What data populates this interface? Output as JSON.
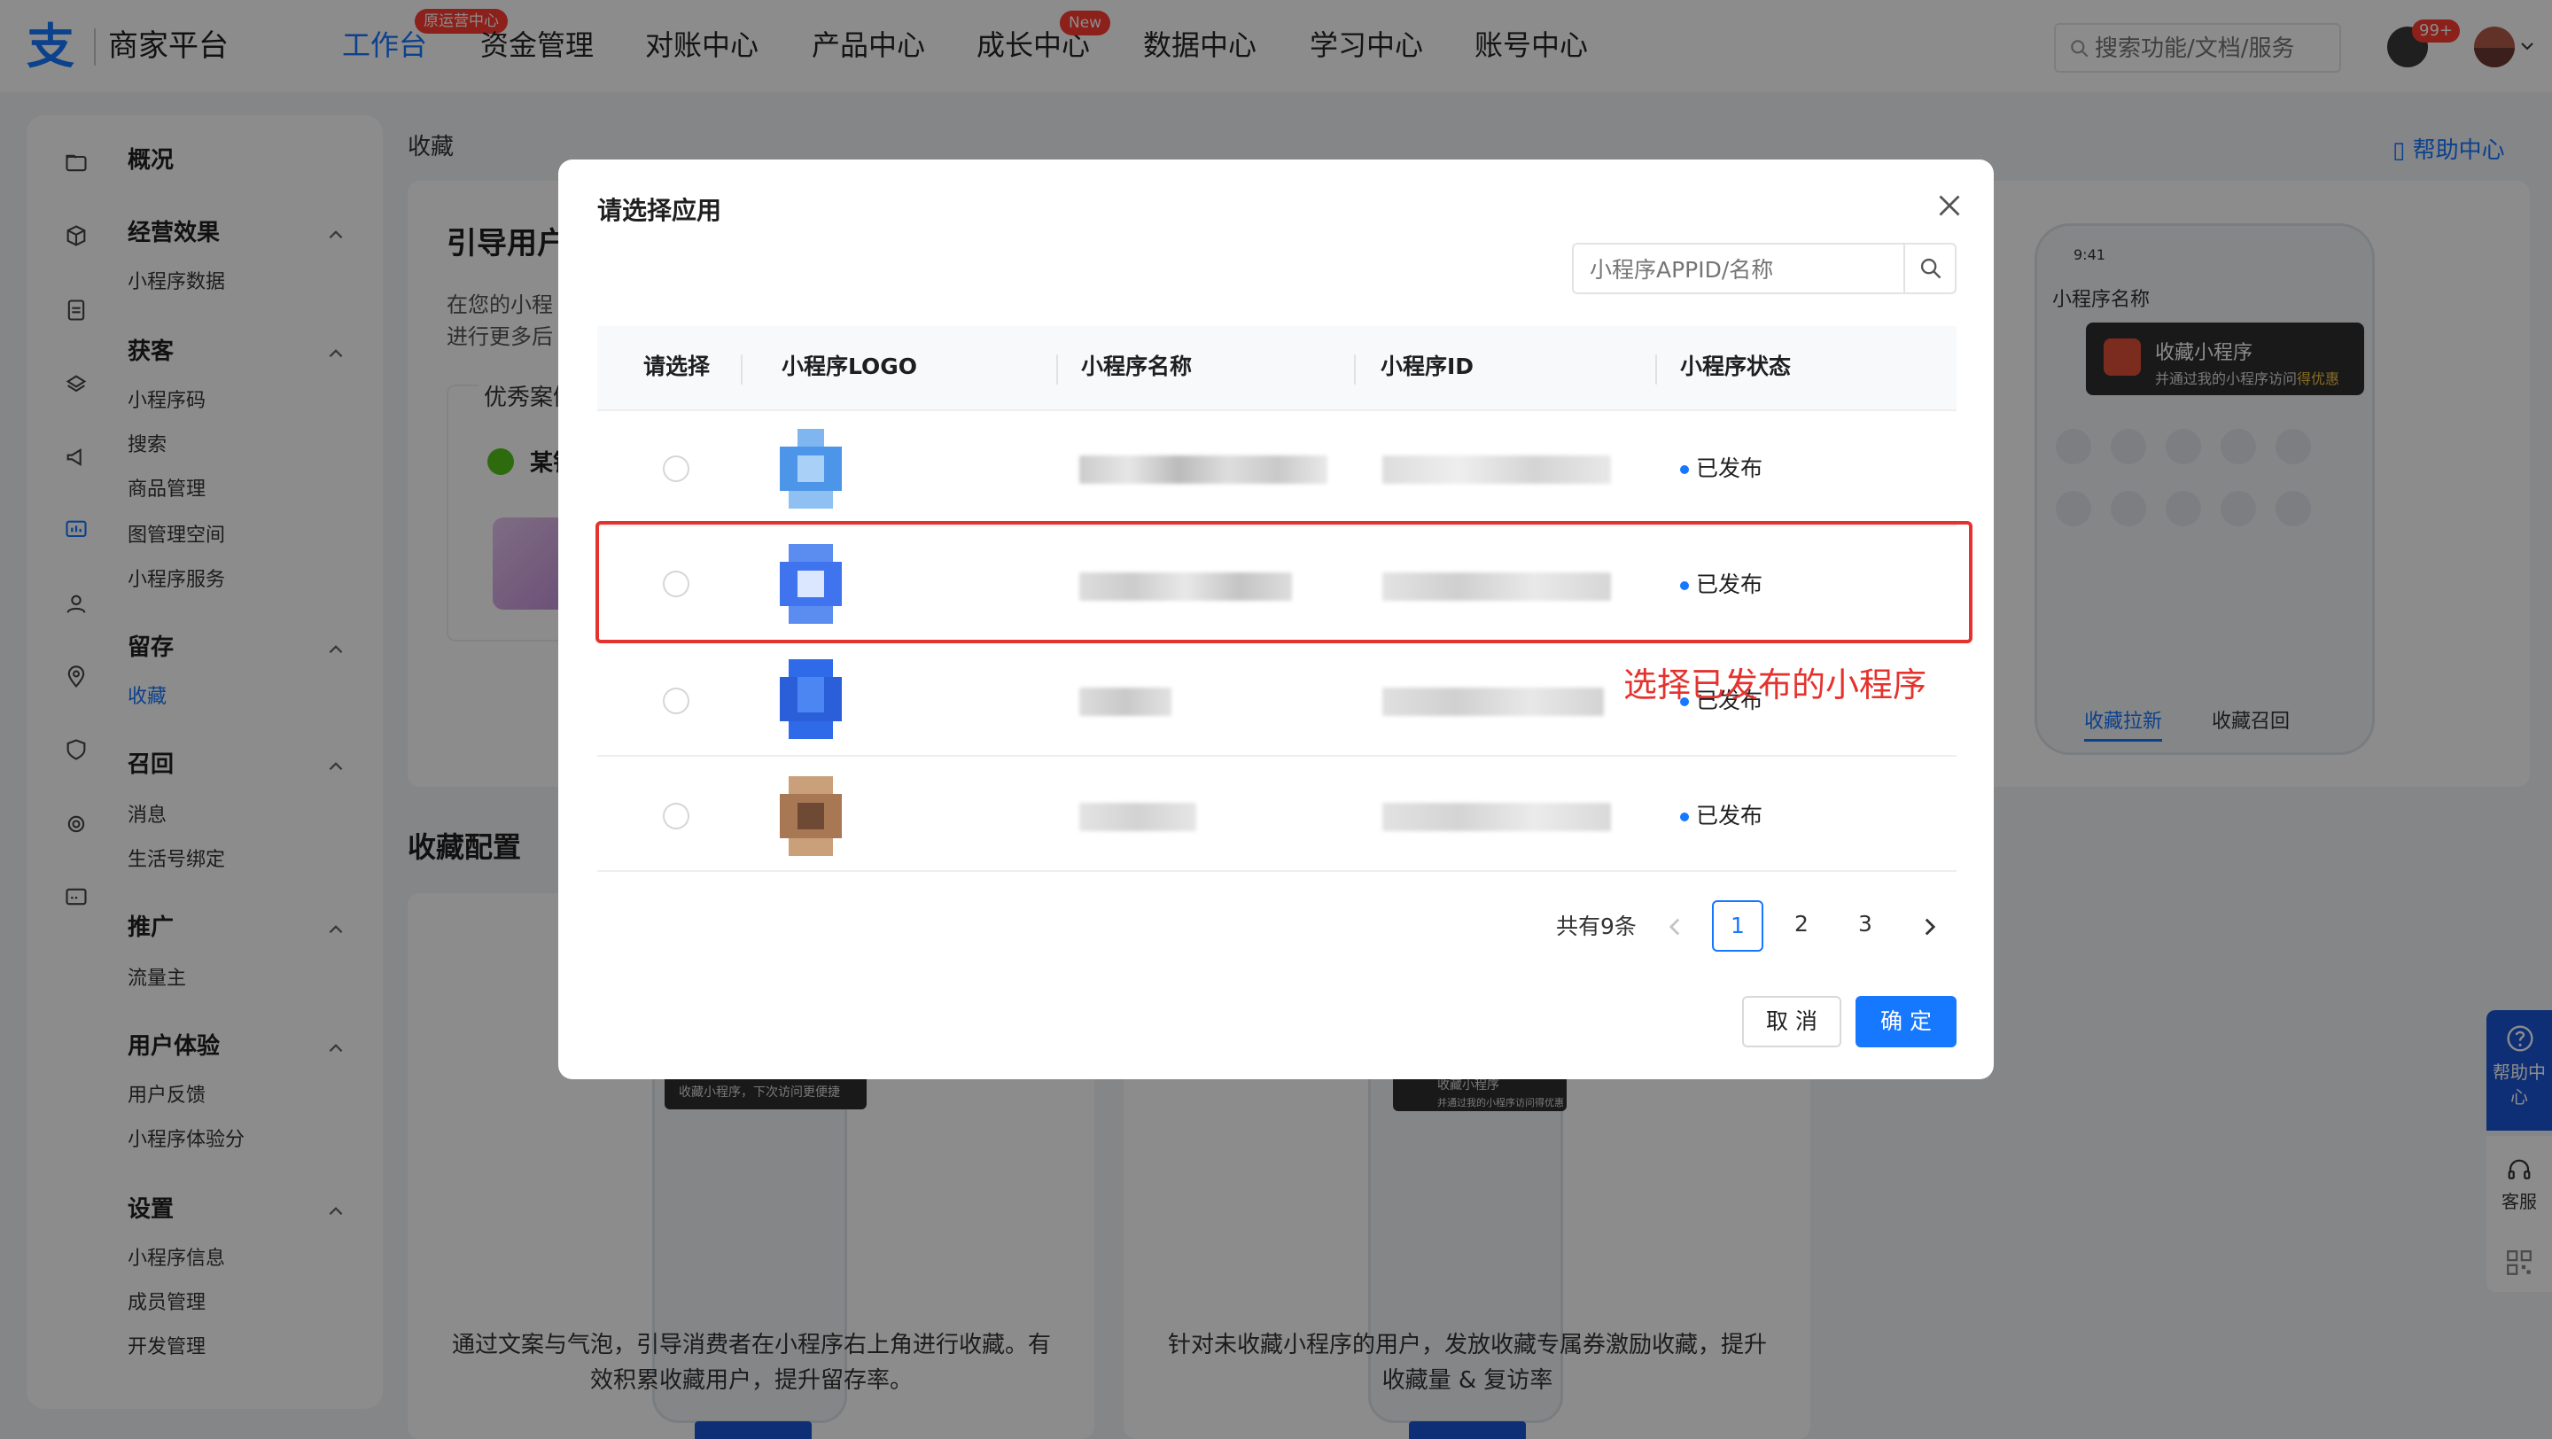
{
  "brand": {
    "logo_glyph": "支",
    "name": "商家平台"
  },
  "nav": {
    "items": [
      {
        "label": "工作台",
        "badge": "原运营中心"
      },
      {
        "label": "资金管理"
      },
      {
        "label": "对账中心"
      },
      {
        "label": "产品中心"
      },
      {
        "label": "成长中心",
        "badge": "New"
      },
      {
        "label": "数据中心"
      },
      {
        "label": "学习中心"
      },
      {
        "label": "账号中心"
      }
    ],
    "search_placeholder": "搜索功能/文档/服务",
    "notifications": "99+"
  },
  "sidebar": {
    "overview": "概况",
    "groups": [
      {
        "title": "经营效果",
        "items": [
          "小程序数据"
        ]
      },
      {
        "title": "获客",
        "items": [
          "小程序码",
          "搜索",
          "商品管理",
          "图管理空间",
          "小程序服务"
        ]
      },
      {
        "title": "留存",
        "items": [
          "收藏"
        ]
      },
      {
        "title": "召回",
        "items": [
          "消息",
          "生活号绑定"
        ]
      },
      {
        "title": "推广",
        "items": [
          "流量主"
        ]
      },
      {
        "title": "用户体验",
        "items": [
          "用户反馈",
          "小程序体验分"
        ]
      },
      {
        "title": "设置",
        "items": [
          "小程序信息",
          "成员管理",
          "开发管理"
        ]
      }
    ]
  },
  "main": {
    "breadcrumb": "收藏",
    "help": "帮助中心",
    "card_title": "引导用户",
    "card_desc_1": "在您的小程",
    "card_desc_2": "进行更多后",
    "case_label": "优秀案例",
    "case_name": "某银",
    "phone": {
      "time": "9:41",
      "title": "小程序名称",
      "tip_title": "收藏小程序",
      "tip_sub_prefix": "并通过我的小程序访问",
      "tip_sub_highlight": "得优惠",
      "tabs": [
        "收藏拉新",
        "收藏召回"
      ]
    },
    "section_title": "收藏配置",
    "config_cards": [
      {
        "tip": "收藏小程序，下次访问更便捷",
        "desc": "通过文案与气泡，引导消费者在小程序右上角进行收藏。有效积累收藏用户，提升留存率。"
      },
      {
        "tip": "收藏小程序",
        "tip_sub": "并通过我的小程序访问得优惠",
        "desc": "针对未收藏小程序的用户，发放收藏专属券激励收藏，提升收藏量 & 复访率"
      }
    ],
    "float_help": "帮助中心",
    "float_cs": "客服"
  },
  "modal": {
    "title": "请选择应用",
    "search_placeholder": "小程序APPID/名称",
    "columns": [
      "请选择",
      "小程序LOGO",
      "小程序名称",
      "小程序ID",
      "小程序状态"
    ],
    "rows": [
      {
        "status": "已发布"
      },
      {
        "status": "已发布"
      },
      {
        "status": "已发布"
      },
      {
        "status": "已发布"
      }
    ],
    "annotation": "选择已发布的小程序",
    "pagination": {
      "total": "共有9条",
      "pages": [
        "1",
        "2",
        "3"
      ],
      "current": "1"
    },
    "cancel": "取 消",
    "confirm": "确 定"
  },
  "colors": {
    "accent": "#1677ff",
    "highlight": "#e4332e"
  }
}
